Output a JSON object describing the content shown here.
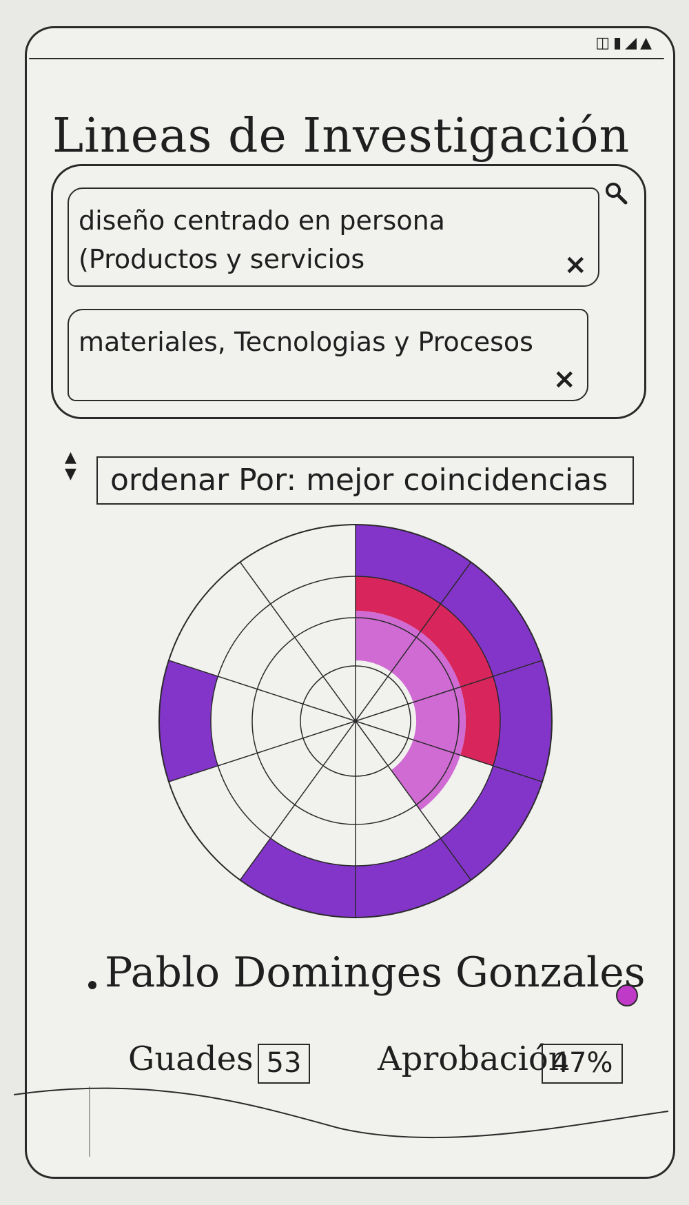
{
  "status_bar": {
    "icons": [
      "notification-icon",
      "battery-icon",
      "signal-icon",
      "wifi-icon"
    ],
    "glyphs": [
      "◫",
      "▮",
      "◢",
      "▲"
    ]
  },
  "header": {
    "title": "Lineas de Investigación"
  },
  "filters": {
    "search_icon": "search-icon",
    "chips": [
      {
        "label": "diseño centrado en persona (Productos y servicios",
        "close": "×"
      },
      {
        "label": "materiales, Tecnologias y Procesos",
        "close": "×"
      }
    ]
  },
  "sort": {
    "arrows": [
      "▲",
      "▼"
    ],
    "label": "ordenar Por: mejor coincidencias"
  },
  "colors": {
    "outer_ring": "#7a25c6",
    "middle_ring": "#d6134f",
    "inner_ring": "#cc5fd0",
    "status_dot": "#c03ac8"
  },
  "radial_chart": {
    "segments_per_ring": 10,
    "rings_from_inside": 4,
    "filled": {
      "outer": [
        0,
        1,
        2,
        3,
        4,
        5,
        7
      ],
      "middle": [
        0,
        1,
        2
      ],
      "inner": [
        0,
        1,
        2,
        3
      ]
    }
  },
  "result": {
    "name": "Pablo Dominges Gonzales",
    "grades_label": "Guades",
    "grades_value": "53",
    "approval_label": "Aprobación",
    "approval_value": "47%"
  }
}
